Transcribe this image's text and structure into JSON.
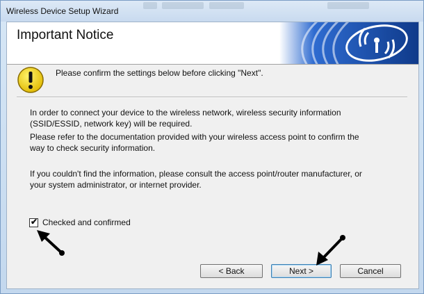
{
  "window": {
    "title": "Wireless Device Setup Wizard"
  },
  "banner": {
    "heading": "Important Notice",
    "logo_icon": "wifi-logo-icon"
  },
  "notice": {
    "icon": "warning-icon",
    "text": "Please confirm the settings below before clicking \"Next\"."
  },
  "body": {
    "para1_line1": "In order to connect your device to the wireless network, wireless security information",
    "para1_line2": "(SSID/ESSID, network key) will be required.",
    "para2_line1": "Please refer to the documentation provided with your wireless access point to confirm the",
    "para2_line2": "way to check security information.",
    "para3_line1": "If you couldn't find the information, please consult the access point/router manufacturer, or",
    "para3_line2": "your system administrator, or internet provider."
  },
  "checkbox": {
    "label": "Checked and confirmed",
    "checked": true,
    "mark": "✔"
  },
  "buttons": {
    "back": "< Back",
    "next": "Next >",
    "cancel": "Cancel"
  },
  "colors": {
    "banner_blue": "#1f4fa6",
    "window_frame": "#c3d8ee",
    "warning_yellow": "#f7d417"
  }
}
